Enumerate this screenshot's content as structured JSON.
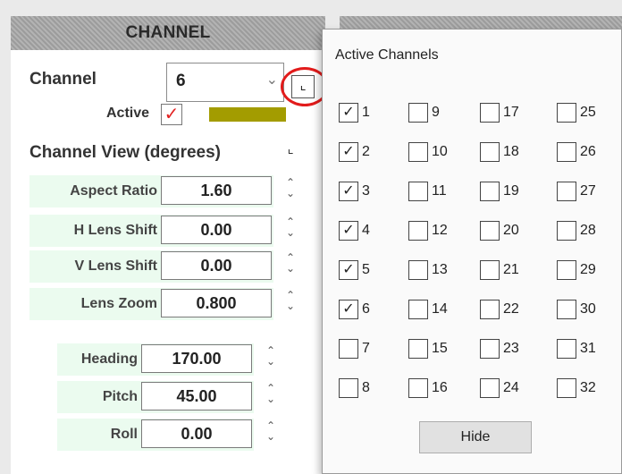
{
  "panel": {
    "title": "CHANNEL",
    "channel_label": "Channel",
    "channel_value": "6",
    "active_label": "Active",
    "active_checked": true,
    "active_color": "#a39c00",
    "view_label": "Channel View (degrees)",
    "lens": [
      {
        "label": "Aspect Ratio",
        "value": "1.60"
      },
      {
        "label": "H Lens Shift",
        "value": "0.00"
      },
      {
        "label": "V Lens Shift",
        "value": "0.00"
      },
      {
        "label": "Lens Zoom",
        "value": "0.800"
      }
    ],
    "orientation": [
      {
        "label": "Heading",
        "value": "170.00"
      },
      {
        "label": "Pitch",
        "value": "45.00"
      },
      {
        "label": "Roll",
        "value": "0.00"
      }
    ]
  },
  "dialog": {
    "title": "Active Channels",
    "channels": [
      {
        "label": "1",
        "checked": true
      },
      {
        "label": "2",
        "checked": true
      },
      {
        "label": "3",
        "checked": true
      },
      {
        "label": "4",
        "checked": true
      },
      {
        "label": "5",
        "checked": true
      },
      {
        "label": "6",
        "checked": true
      },
      {
        "label": "7",
        "checked": false
      },
      {
        "label": "8",
        "checked": false
      },
      {
        "label": "9",
        "checked": false
      },
      {
        "label": "10",
        "checked": false
      },
      {
        "label": "11",
        "checked": false
      },
      {
        "label": "12",
        "checked": false
      },
      {
        "label": "13",
        "checked": false
      },
      {
        "label": "14",
        "checked": false
      },
      {
        "label": "15",
        "checked": false
      },
      {
        "label": "16",
        "checked": false
      },
      {
        "label": "17",
        "checked": false
      },
      {
        "label": "18",
        "checked": false
      },
      {
        "label": "19",
        "checked": false
      },
      {
        "label": "20",
        "checked": false
      },
      {
        "label": "21",
        "checked": false
      },
      {
        "label": "22",
        "checked": false
      },
      {
        "label": "23",
        "checked": false
      },
      {
        "label": "24",
        "checked": false
      },
      {
        "label": "25",
        "checked": false
      },
      {
        "label": "26",
        "checked": false
      },
      {
        "label": "27",
        "checked": false
      },
      {
        "label": "28",
        "checked": false
      },
      {
        "label": "29",
        "checked": false
      },
      {
        "label": "30",
        "checked": false
      },
      {
        "label": "31",
        "checked": false
      },
      {
        "label": "32",
        "checked": false
      }
    ],
    "hide_label": "Hide"
  },
  "colors": {
    "highlight": "#e21b1b",
    "row_bg": "#ebfbef"
  }
}
